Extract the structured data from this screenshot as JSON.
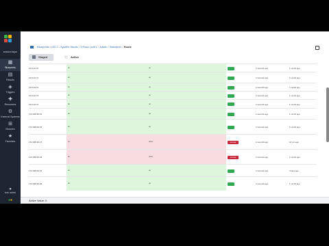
{
  "colors": {
    "sidebar_bg": "#1e2430",
    "green_row": "#def6dc",
    "red_row": "#f8dde0",
    "ok": "#2fa84f",
    "error": "#c62839",
    "link": "#2e6db4"
  },
  "brand": {
    "name": "session layer"
  },
  "nav": [
    {
      "label": "Blueprints",
      "icon": "blueprint-icon",
      "active": true
    },
    {
      "label": "Results",
      "icon": "results-icon",
      "active": false
    },
    {
      "label": "Triggers",
      "icon": "trigger-icon",
      "active": false
    },
    {
      "label": "Resources",
      "icon": "resources-icon",
      "active": false
    },
    {
      "label": "External Systems",
      "icon": "external-icon",
      "active": false
    },
    {
      "label": "Modules",
      "icon": "modules-icon",
      "active": false
    },
    {
      "label": "Favorites",
      "icon": "star-icon",
      "active": false
    }
  ],
  "user": {
    "label": "ivan admin"
  },
  "breadcrumb": [
    "Blueprints",
    "OD 2",
    "System Studio",
    "3 Race Leaf 1",
    "Admin",
    "Wanderer",
    "Route"
  ],
  "toolbar": {
    "staged_label": "Staged",
    "active_label": "Active"
  },
  "rows": [
    {
      "name": "10.0.10.70",
      "col1": "ok",
      "col2": "up",
      "status": "ok",
      "time1": "2 seconds ago",
      "time2": "1 month ago",
      "kind": "green"
    },
    {
      "name": "10.0.10.71",
      "col1": "ok",
      "col2": "up",
      "status": "ok",
      "time1": "2 seconds ago",
      "time2": "1 month ago",
      "kind": "green"
    },
    {
      "name": "10.0.10.72",
      "col1": "ok",
      "col2": "up",
      "status": "ok",
      "time1": "2 seconds ago",
      "time2": "1 month ago",
      "kind": "green"
    },
    {
      "name": "10.0.10.73",
      "col1": "ok",
      "col2": "up",
      "status": "ok",
      "time1": "2 seconds ago",
      "time2": "1 month ago",
      "kind": "green"
    },
    {
      "name": "10.0.10.74",
      "col1": "ok",
      "col2": "up",
      "status": "ok",
      "time1": "2 seconds ago",
      "time2": "1 month ago",
      "kind": "green"
    },
    {
      "name": "172.168.30.15",
      "col1": "ok",
      "col2": "up",
      "status": "ok",
      "time1": "2 seconds ago",
      "time2": "1 month ago",
      "kind": "green"
    },
    {
      "name": "172.168.30.16",
      "col1": "ok",
      "col2": "up",
      "status": "ok",
      "time1": "2 seconds ago",
      "time2": "1 month ago",
      "kind": "green"
    },
    {
      "name": "172.168.30.17",
      "col1": "ok",
      "col2": "down",
      "status": "error",
      "time1": "2 seconds ago",
      "time2": "10 min ago",
      "kind": "red"
    },
    {
      "name": "172.168.30.18",
      "col1": "ok",
      "col2": "down",
      "status": "error",
      "time1": "2 seconds ago",
      "time2": "1 month ago",
      "kind": "red"
    },
    {
      "name": "172.168.30.19",
      "col1": "ok",
      "col2": "up",
      "status": "ok",
      "time1": "2 seconds ago",
      "time2": "3 days ago",
      "kind": "green"
    },
    {
      "name": "172.168.30.20",
      "col1": "ok",
      "col2": "up",
      "status": "ok",
      "time1": "2 seconds ago",
      "time2": "1 month ago",
      "kind": "green"
    }
  ],
  "status_labels": {
    "error": "anomaly"
  },
  "bottom_bar": {
    "label": "Active Value: 0"
  }
}
